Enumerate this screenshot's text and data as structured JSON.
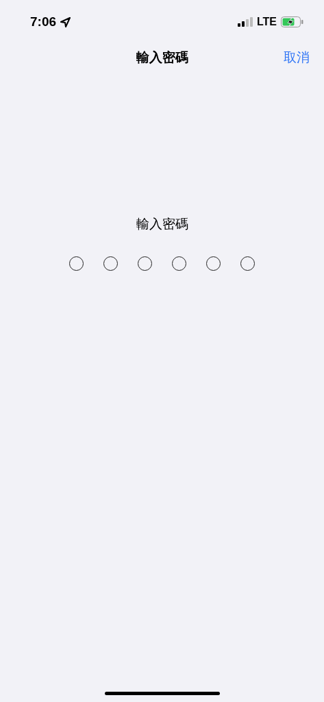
{
  "status_bar": {
    "time": "7:06",
    "network": "LTE"
  },
  "nav_bar": {
    "title": "輸入密碼",
    "cancel": "取消"
  },
  "passcode": {
    "prompt": "輸入密碼",
    "dots": [
      {
        "filled": false
      },
      {
        "filled": false
      },
      {
        "filled": false
      },
      {
        "filled": false
      },
      {
        "filled": false
      },
      {
        "filled": false
      }
    ]
  }
}
